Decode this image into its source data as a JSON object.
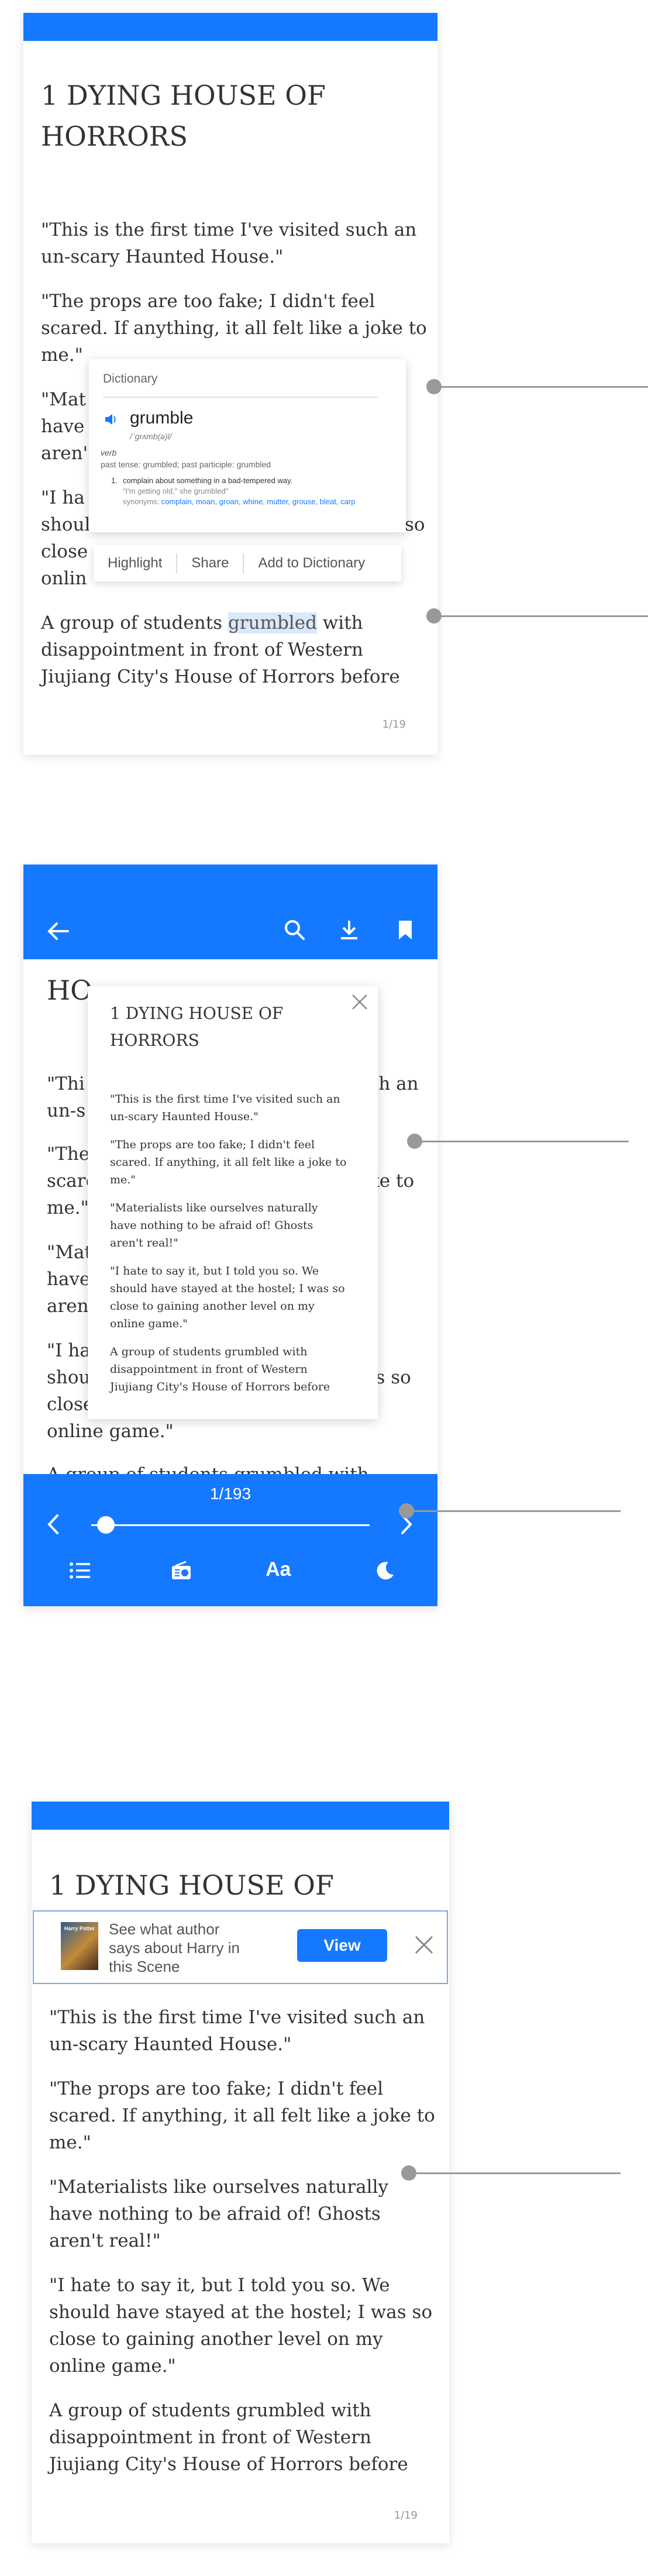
{
  "screen1": {
    "chapter_title_line1": "1 DYING HOUSE OF",
    "chapter_title_line2": "HORRORS",
    "p1_l1": "\"This is the first time I've visited such an",
    "p1_l2": "un-scary Haunted House.\"",
    "p2_l1": "\"The props are too fake; I didn't feel",
    "p2_l2": "scared. If anything, it all felt like a joke to",
    "p2_l3": "me.\"",
    "p3_l1": "\"Mat",
    "p3_l2": "have",
    "p3_l3": "aren'",
    "p4_l1": "\"I ha",
    "p4_l2": "shoul",
    "p4_l2_right": "so",
    "p4_l3": "close",
    "p4_l4": "onlin",
    "p5_l1_pre": "A group of students ",
    "p5_l1_highlight": "grumbled",
    "p5_l1_post": " with",
    "p5_l2": "disappointment in front of Western",
    "p5_l3": "Jiujiang City's House of Horrors before",
    "page_number": "1/19",
    "dictionary": {
      "header": "Dictionary",
      "word": "grumble",
      "phonetic": "/ˈɡrʌmb(ə)l/",
      "pos": "verb",
      "forms": "past tense: grumbled; past participle: grumbled",
      "definition_number": "1.",
      "definition": "complain about something in a bad-tempered way.",
      "example": "\"I'm getting old,\" she grumbled\"",
      "synonyms_label": "synonyms:",
      "synonyms": "complain, moan, groan, whine, mutter, grouse, bleat, carp"
    },
    "menu": {
      "highlight": "Highlight",
      "share": "Share",
      "add": "Add to Dictionary"
    }
  },
  "screen2": {
    "title_peek_line1": "1 DYING HOUSE OF",
    "title_peek_line2": "HO",
    "bg_p1_l1": "\"Thi",
    "bg_p1_l1_right": "ch an",
    "bg_p1_l2": "un-s",
    "bg_p2_l1": "\"The",
    "bg_p2_l2": "scare",
    "bg_p2_l2_right": "ke to",
    "bg_p2_l3": "me.\"",
    "bg_p3_l1": "\"Mat",
    "bg_p3_l2": "have",
    "bg_p3_l3": "aren'",
    "bg_p4_l1": "\"I ha",
    "bg_p4_l2": "shou",
    "bg_p4_l2_right": "as so",
    "bg_p4_l3": "close",
    "bg_p4_l4": "online game.\"",
    "bg_p5_l1": "A group of students grumbled with",
    "popup": {
      "title_l1": "1 DYING HOUSE OF",
      "title_l2": "HORRORS",
      "p1_l1": "\"This is the first time I've visited such an",
      "p1_l2": "un-scary Haunted House.\"",
      "p2_l1": "\"The props are too fake; I didn't feel",
      "p2_l2": "scared. If anything, it all felt like a joke to",
      "p2_l3": "me.\"",
      "p3_l1": "\"Materialists like ourselves naturally",
      "p3_l2": "have nothing to be afraid of! Ghosts",
      "p3_l3": "aren't real!\"",
      "p4_l1": "\"I hate to say it, but I told you so. We",
      "p4_l2": "should have stayed at the hostel; I was so",
      "p4_l3": "close to gaining another level on my",
      "p4_l4": "online game.\"",
      "p5_l1": "A group of students grumbled with",
      "p5_l2": "disappointment in front of Western",
      "p5_l3": "Jiujiang City's House of Horrors before"
    },
    "progress_label": "1/193",
    "progress_fraction": 0.005,
    "toolbar_text_size_label": "Aa"
  },
  "screen3": {
    "chapter_title": "1 DYING HOUSE OF",
    "banner_text_l1": "See what author",
    "banner_text_l2": "says about Harry in",
    "banner_text_l3": "this Scene",
    "banner_cover_text": "Harry Potter",
    "view_button": "View",
    "p1_l1": "\"This is the first time I've visited such an",
    "p1_l2": "un-scary Haunted House.\"",
    "p2_l1": "\"The props are too fake; I didn't feel",
    "p2_l2": "scared. If anything, it all felt like a joke to",
    "p2_l3": "me.\"",
    "p3_l1": "\"Materialists like ourselves naturally",
    "p3_l2": "have nothing to be afraid of! Ghosts",
    "p3_l3": "aren't real!\"",
    "p4_l1": "\"I hate to say it, but I told you so. We",
    "p4_l2": "should have stayed at the hostel; I was so",
    "p4_l3": "close to gaining another level on my",
    "p4_l4": "online game.\"",
    "p5_l1": "A group of students grumbled with",
    "p5_l2": "disappointment in front of Western",
    "p5_l3": "Jiujiang City's House of Horrors before",
    "page_number": "1/19"
  },
  "colors": {
    "accent": "#1479ff",
    "highlight": "#dbe7fb",
    "text": "#333333",
    "callout": "#999999"
  }
}
